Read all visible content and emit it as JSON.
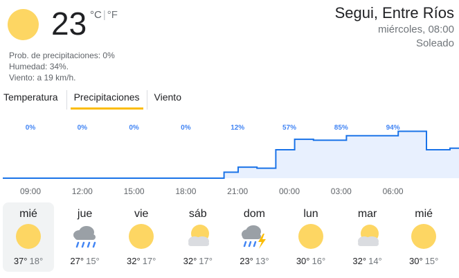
{
  "current": {
    "temperature": "23",
    "unit_c": "°C",
    "unit_sep": "|",
    "unit_f": "°F",
    "icon": "sun-icon",
    "precip": "Prob. de precipitaciones: 0%",
    "humidity": "Humedad: 34%.",
    "wind": "Viento: a 19 km/h."
  },
  "location": {
    "city": "Segui, Entre Ríos",
    "datetime": "miércoles, 08:00",
    "condition": "Soleado"
  },
  "tabs": [
    "Temperatura",
    "Precipitaciones",
    "Viento"
  ],
  "active_tab": "Precipitaciones",
  "colors": {
    "sun": "#fdd663",
    "accent_tab": "#fbbc04",
    "precip_line": "#1a73e8",
    "precip_fill": "#e8f0fe",
    "pct_text": "#4285f4"
  },
  "chart_data": {
    "type": "area",
    "title": "",
    "ylabel": "",
    "ylim": [
      0,
      100
    ],
    "unit": "%",
    "time_labels": [
      "09:00",
      "12:00",
      "15:00",
      "18:00",
      "21:00",
      "00:00",
      "03:00",
      "06:00"
    ],
    "hourly": [
      0,
      0,
      0,
      0,
      0,
      0,
      0,
      0,
      0,
      0,
      0,
      0,
      0,
      0,
      0,
      0,
      0,
      0,
      0,
      0,
      0,
      0,
      0,
      0,
      0,
      0,
      0,
      0,
      0,
      0,
      0,
      0,
      0,
      0,
      0,
      0,
      0,
      0,
      0,
      0,
      0,
      0,
      0,
      0,
      0,
      0,
      0,
      12,
      12,
      12,
      22,
      22,
      22,
      22,
      20,
      20,
      20,
      20,
      57,
      57,
      57,
      57,
      78,
      78,
      78,
      78,
      76,
      76,
      76,
      76,
      76,
      76,
      76,
      85,
      85,
      85,
      85,
      85,
      85,
      85,
      85,
      85,
      85,
      85,
      94,
      94,
      94,
      94,
      94,
      94,
      57,
      57,
      57,
      57,
      57,
      60,
      60
    ],
    "labels": [
      "0%",
      "0%",
      "0%",
      "0%",
      "12%",
      "57%",
      "85%",
      "94%"
    ],
    "label_hour_index": [
      0,
      11,
      22,
      33,
      44,
      55,
      66,
      77
    ]
  },
  "forecast": [
    {
      "day": "mié",
      "icon": "sun-icon",
      "high": "37°",
      "low": "18°"
    },
    {
      "day": "jue",
      "icon": "rain-cloud-icon",
      "high": "27°",
      "low": "15°"
    },
    {
      "day": "vie",
      "icon": "sun-icon",
      "high": "32°",
      "low": "17°"
    },
    {
      "day": "sáb",
      "icon": "partly-cloudy-icon",
      "high": "32°",
      "low": "17°"
    },
    {
      "day": "dom",
      "icon": "thunderstorm-icon",
      "high": "23°",
      "low": "13°"
    },
    {
      "day": "lun",
      "icon": "sun-icon",
      "high": "30°",
      "low": "16°"
    },
    {
      "day": "mar",
      "icon": "partly-cloudy-icon",
      "high": "32°",
      "low": "14°"
    },
    {
      "day": "mié",
      "icon": "sun-icon",
      "high": "30°",
      "low": "15°"
    }
  ]
}
